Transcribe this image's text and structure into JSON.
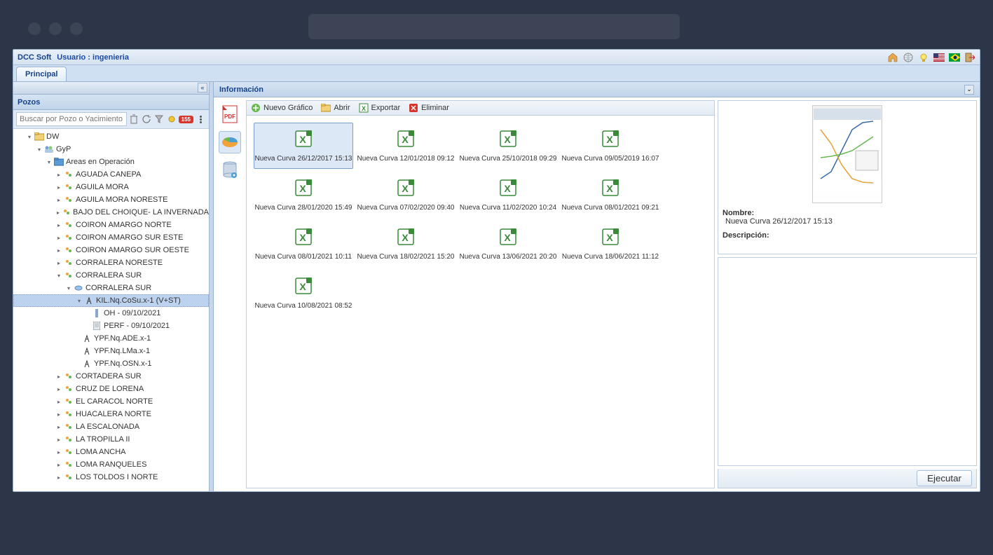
{
  "header": {
    "app_name": "DCC Soft",
    "user_label": "Usuario : ingenieria"
  },
  "tabs": {
    "principal": "Principal"
  },
  "sidebar": {
    "title": "Pozos",
    "search_placeholder": "Buscar por Pozo o Yacimiento",
    "badge": "155",
    "tree": {
      "root": "DW",
      "gyp": "GyP",
      "areas": "Areas en Operación",
      "items": [
        "AGUADA CANEPA",
        "AGUILA MORA",
        "AGUILA MORA NORESTE",
        "BAJO DEL CHOIQUE- LA INVERNADA",
        "COIRON AMARGO NORTE",
        "COIRON AMARGO SUR ESTE",
        "COIRON AMARGO SUR OESTE",
        "CORRALERA NORESTE",
        "CORRALERA SUR"
      ],
      "corralera_sub": "CORRALERA SUR",
      "well": "KIL.Nq.CoSu.x-1 (V+ST)",
      "oh": "OH - 09/10/2021",
      "perf": "PERF - 09/10/2021",
      "wells2": [
        "YPF.Nq.ADE.x-1",
        "YPF.Nq.LMa.x-1",
        "YPF.Nq.OSN.x-1"
      ],
      "items2": [
        "CORTADERA SUR",
        "CRUZ DE LORENA",
        "EL CARACOL NORTE",
        "HUACALERA NORTE",
        "LA ESCALONADA",
        "LA TROPILLA II",
        "LOMA ANCHA",
        "LOMA RANQUELES",
        "LOS TOLDOS I NORTE"
      ]
    }
  },
  "main": {
    "title": "Información",
    "actions": {
      "nuevo": "Nuevo Gráfico",
      "abrir": "Abrir",
      "exportar": "Exportar",
      "eliminar": "Eliminar"
    },
    "files": [
      "Nueva Curva 26/12/2017 15:13",
      "Nueva Curva 12/01/2018 09:12",
      "Nueva Curva 25/10/2018 09:29",
      "Nueva Curva 09/05/2019 16:07",
      "Nueva Curva 28/01/2020 15:49",
      "Nueva Curva 07/02/2020 09:40",
      "Nueva Curva 11/02/2020 10:24",
      "Nueva Curva 08/01/2021 09:21",
      "Nueva Curva 08/01/2021 10:11",
      "Nueva Curva 18/02/2021 15:20",
      "Nueva Curva 13/06/2021 20:20",
      "Nueva Curva 18/06/2021 11:12",
      "Nueva Curva 10/08/2021 08:52"
    ],
    "details": {
      "nombre_label": "Nombre:",
      "nombre_value": "Nueva Curva 26/12/2017 15:13",
      "desc_label": "Descripción:"
    },
    "execute": "Ejecutar"
  }
}
